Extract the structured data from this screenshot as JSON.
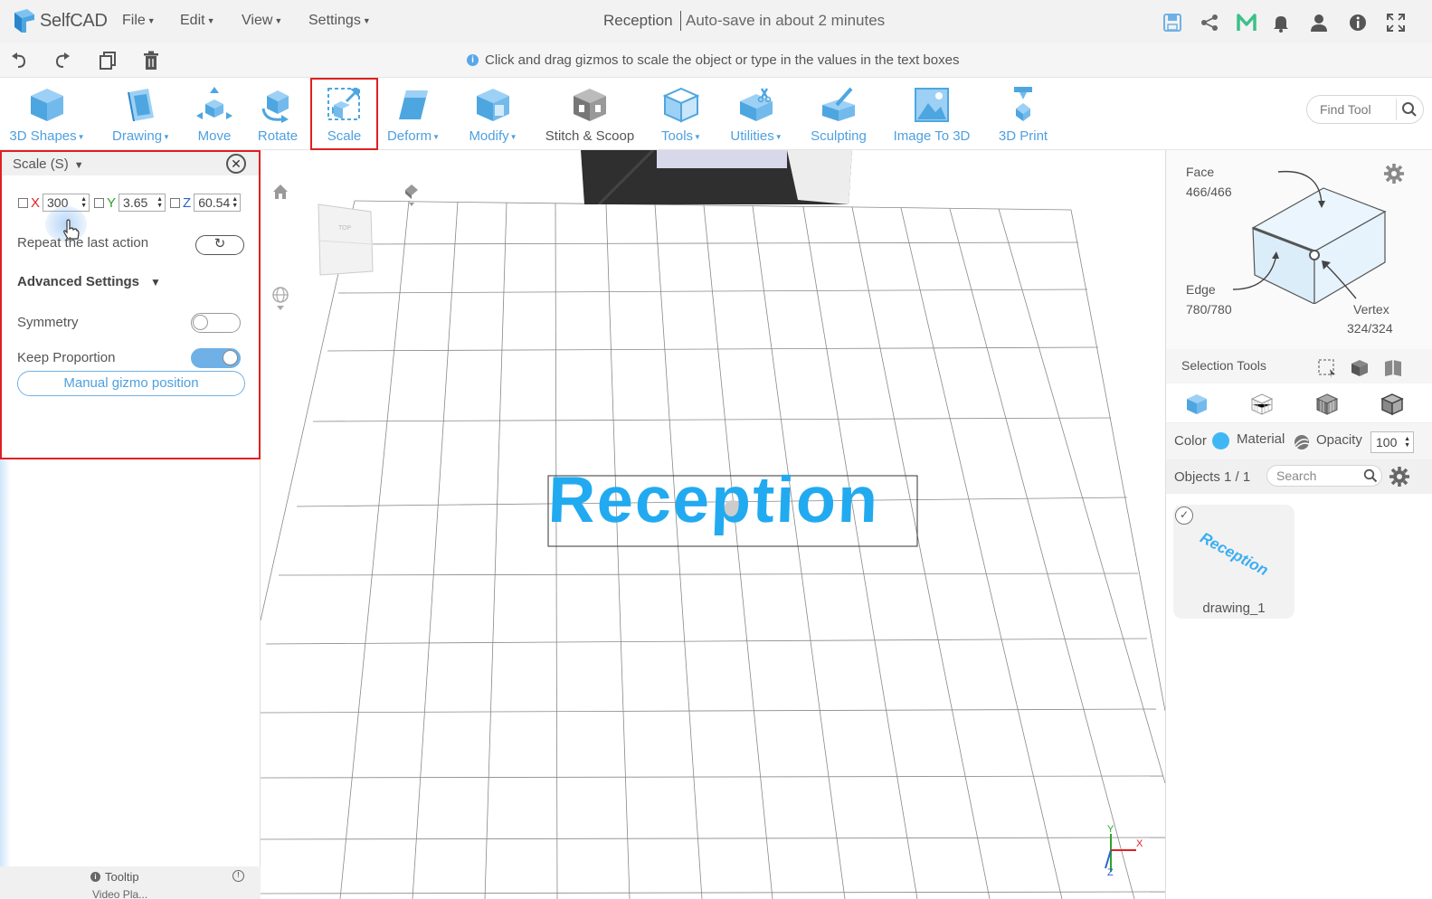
{
  "app": {
    "name": "SelfCAD"
  },
  "menu": [
    {
      "label": "File"
    },
    {
      "label": "Edit"
    },
    {
      "label": "View"
    },
    {
      "label": "Settings"
    }
  ],
  "document": {
    "title": "Reception",
    "autosave": "Auto-save in about 2 minutes"
  },
  "hint": "Click and drag gizmos to scale the object or type in the values in the text boxes",
  "toolbar": {
    "tools": [
      {
        "label": "3D Shapes"
      },
      {
        "label": "Drawing"
      },
      {
        "label": "Move"
      },
      {
        "label": "Rotate"
      },
      {
        "label": "Scale"
      },
      {
        "label": "Deform"
      },
      {
        "label": "Modify"
      },
      {
        "label": "Stitch & Scoop"
      },
      {
        "label": "Tools"
      },
      {
        "label": "Utilities"
      },
      {
        "label": "Sculpting"
      },
      {
        "label": "Image To 3D"
      },
      {
        "label": "3D Print"
      }
    ],
    "find_placeholder": "Find Tool"
  },
  "scale_panel": {
    "title": "Scale (S)",
    "x_label": "X",
    "x_value": "300",
    "y_label": "Y",
    "y_value": "3.65",
    "z_label": "Z",
    "z_value": "60.54",
    "repeat_label": "Repeat the last action",
    "advanced_label": "Advanced Settings",
    "symmetry_label": "Symmetry",
    "symmetry_on": false,
    "keep_proportion_label": "Keep Proportion",
    "keep_proportion_on": true,
    "gizmo_button": "Manual gizmo position"
  },
  "tooltip": {
    "label": "Tooltip",
    "video_label": "Video Pla..."
  },
  "viewport": {
    "object_text": "Reception"
  },
  "selection_info": {
    "face_label": "Face",
    "face_count": "466/466",
    "edge_label": "Edge",
    "edge_count": "780/780",
    "vertex_label": "Vertex",
    "vertex_count": "324/324",
    "tools_label": "Selection Tools"
  },
  "properties": {
    "color_label": "Color",
    "color_value": "#3fb7f5",
    "material_label": "Material",
    "opacity_label": "Opacity",
    "opacity_value": "100"
  },
  "objects": {
    "count_label": "Objects 1 / 1",
    "search_placeholder": "Search",
    "items": [
      {
        "name": "drawing_1",
        "thumb_text": "Reception",
        "selected": true
      }
    ]
  },
  "colors": {
    "accent": "#4ea0df",
    "active_border": "#e02020",
    "object": "#22aaf0"
  }
}
